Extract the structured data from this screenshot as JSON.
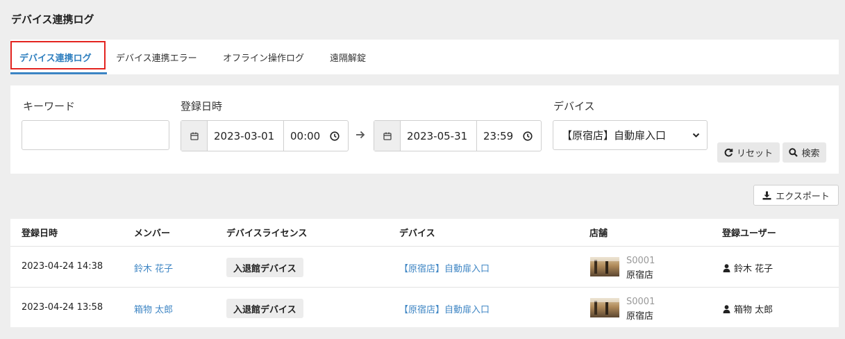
{
  "page": {
    "title": "デバイス連携ログ"
  },
  "tabs": [
    {
      "label": "デバイス連携ログ",
      "active": true
    },
    {
      "label": "デバイス連携エラー",
      "active": false
    },
    {
      "label": "オフライン操作ログ",
      "active": false
    },
    {
      "label": "遠隔解錠",
      "active": false
    }
  ],
  "filters": {
    "keyword": {
      "label": "キーワード",
      "value": "",
      "placeholder": ""
    },
    "date": {
      "label": "登録日時",
      "from_date": "2023-03-01",
      "from_time": "00:00",
      "to_date": "2023-05-31",
      "to_time": "23:59"
    },
    "device": {
      "label": "デバイス",
      "selected": "【原宿店】自動扉入口"
    },
    "reset_label": "リセット",
    "search_label": "検索"
  },
  "export_label": "エクスポート",
  "table": {
    "headers": [
      "登録日時",
      "メンバー",
      "デバイスライセンス",
      "デバイス",
      "店舗",
      "登録ユーザー"
    ],
    "rows": [
      {
        "datetime": "2023-04-24 14:38",
        "member": "鈴木 花子",
        "license": "入退館デバイス",
        "device": "【原宿店】自動扉入口",
        "store_code": "S0001",
        "store_name": "原宿店",
        "user": "鈴木 花子"
      },
      {
        "datetime": "2023-04-24 13:58",
        "member": "箱物 太郎",
        "license": "入退館デバイス",
        "device": "【原宿店】自動扉入口",
        "store_code": "S0001",
        "store_name": "原宿店",
        "user": "箱物 太郎"
      }
    ]
  },
  "colors": {
    "link": "#3f86c4",
    "highlight_box": "#e3231f",
    "tab_underline": "#3b84c4"
  }
}
